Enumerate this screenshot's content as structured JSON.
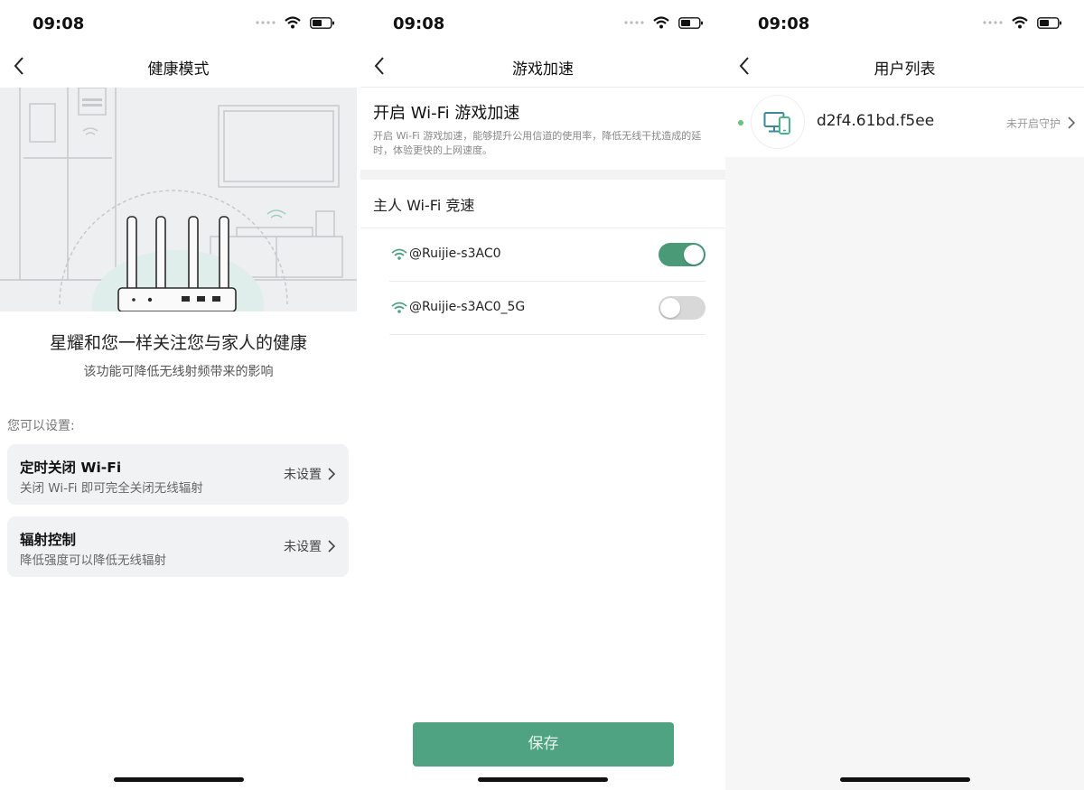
{
  "status_bar": {
    "time": "09:08"
  },
  "screens": [
    {
      "title": "健康模式",
      "headline": "星耀和您一样关注您与家人的健康",
      "subline": "该功能可降低无线射频带来的影响",
      "settings_label": "您可以设置:",
      "cards": [
        {
          "title": "定时关闭 Wi-Fi",
          "subtitle": "关闭 Wi-Fi 即可完全关闭无线辐射",
          "value": "未设置"
        },
        {
          "title": "辐射控制",
          "subtitle": "降低强度可以降低无线辐射",
          "value": "未设置"
        }
      ]
    },
    {
      "title": "游戏加速",
      "section_title": "开启 Wi-Fi 游戏加速",
      "section_desc": "开启 Wi-Fi 游戏加速，能够提升公用信道的使用率，降低无线干扰造成的延时，体验更快的上网速度。",
      "host_title": "主人 Wi-Fi 竞速",
      "networks": [
        {
          "ssid": "@Ruijie-s3AC0",
          "enabled": true
        },
        {
          "ssid": "@Ruijie-s3AC0_5G",
          "enabled": false
        }
      ],
      "save_label": "保存"
    },
    {
      "title": "用户列表",
      "users": [
        {
          "name": "d2f4.61bd.f5ee",
          "status": "未开启守护",
          "online": true
        }
      ]
    }
  ],
  "colors": {
    "accent": "#4fa382",
    "toggle_on": "#4a9a78",
    "toggle_off": "#d8d8d8",
    "online_dot": "#6cc17f",
    "card_bg": "#f1f2f4",
    "device_icon": "#3a8a9a"
  }
}
